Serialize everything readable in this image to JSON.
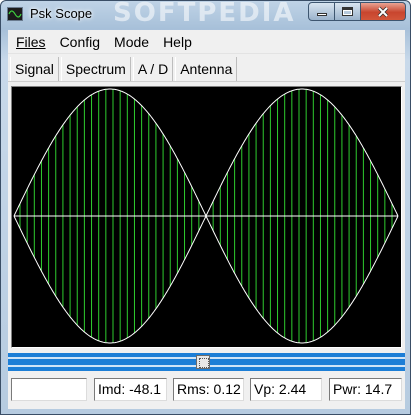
{
  "window": {
    "title": "Psk Scope",
    "watermark": "SOFTPEDIA"
  },
  "menu": {
    "items": [
      "Files",
      "Config",
      "Mode",
      "Help"
    ]
  },
  "tabs": [
    "Signal",
    "Spectrum",
    "A / D",
    "Antenna"
  ],
  "scope": {
    "background": "#000000",
    "trace_color": "#2ecc2e",
    "envelope_color": "#ffffff",
    "carrier_cycles": 53,
    "envelope_lobes": 2
  },
  "slider": {
    "track_color": "#1c7ed6",
    "position": 0.49
  },
  "status": {
    "field0": "",
    "imd": "Imd: -48.1",
    "rms": "Rms: 0.12",
    "vp": "Vp: 2.44",
    "pwr": "Pwr: 14.7"
  }
}
